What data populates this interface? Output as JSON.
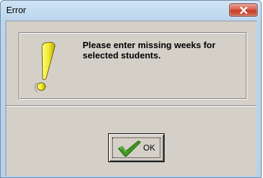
{
  "window": {
    "title": "Error",
    "close_icon": "close-icon"
  },
  "message": {
    "icon": "exclamation-icon",
    "text": "Please enter missing weeks for selected students."
  },
  "buttons": {
    "ok_label": "OK",
    "ok_icon": "checkmark-icon"
  },
  "colors": {
    "exclamation": "#f2ea2f",
    "checkmark": "#3f9a1e",
    "close_button": "#c9452d"
  }
}
